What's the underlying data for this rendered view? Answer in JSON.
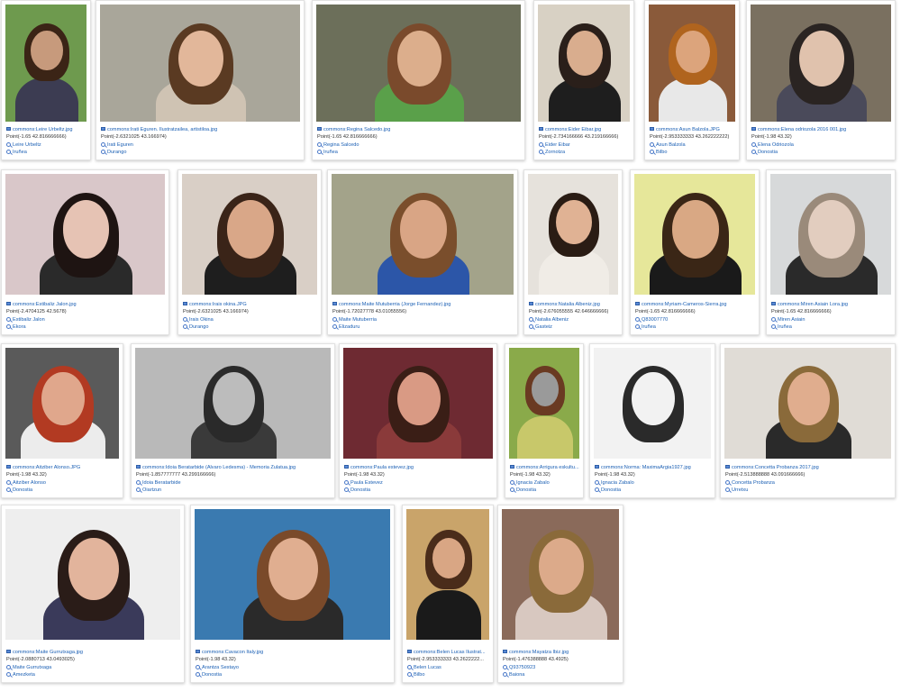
{
  "theme": {
    "link_color": "#1a5fb4",
    "card_border": "#e2e2e2",
    "point_text": "#333333"
  },
  "gallery": {
    "items": [
      {
        "file": "commons:Leire Urbeltz.jpg",
        "point": "Point(-1.65 42.816666666)",
        "person": "Leire Urbeltz",
        "place": "Iruñea",
        "bg": "#6e9a4e",
        "skin": "#c79a7c",
        "hair": "#3b2416",
        "cloth": "#3c3c52"
      },
      {
        "file": "commons:Irati Eguren. Ilustratzailea, artistiloa.jpg",
        "point": "Point(-2.6321025 43.166974)",
        "person": "Irati Eguren",
        "place": "Durango",
        "bg": "#a9a69a",
        "skin": "#e2b79a",
        "hair": "#5a3a22",
        "cloth": "#cfc3b3"
      },
      {
        "file": "commons:Regina Salcedo.jpg",
        "point": "Point(-1.65 42.816666666)",
        "person": "Regina Salcedo",
        "place": "Iruñea",
        "bg": "#6c6f5a",
        "skin": "#dcae8c",
        "hair": "#7a4a2c",
        "cloth": "#5aa04a"
      },
      {
        "file": "commons:Eider Eibar.jpg",
        "point": "Point(-2.734166666 43.219166666)",
        "person": "Eider Eibar",
        "place": "Zornotza",
        "bg": "#d8d1c4",
        "skin": "#d9ad8e",
        "hair": "#2a1f1a",
        "cloth": "#1e1e1e"
      },
      {
        "file": "commons:Asun Balzola.JPG",
        "point": "Point(-2.953333333 43.262222222)",
        "person": "Asun Balzola",
        "place": "Bilbo",
        "bg": "#8a5a3a",
        "skin": "#dca47c",
        "hair": "#b0641e",
        "cloth": "#e8e8e8"
      },
      {
        "file": "commons:Elena odriozola 2016 001.jpg",
        "point": "Point(-1.98 43.32)",
        "person": "Elena Odriozola",
        "place": "Donostia",
        "bg": "#7a7060",
        "skin": "#e0c2ad",
        "hair": "#2a2422",
        "cloth": "#4a4a5a"
      },
      {
        "file": "commons:Estibaliz Jalon.jpg",
        "point": "Point(-2.4704125 42.5678)",
        "person": "Estibaliz Jalon",
        "place": "Ekora",
        "bg": "#d9c7c9",
        "skin": "#e6c3b4",
        "hair": "#1e1412",
        "cloth": "#2a2a2a"
      },
      {
        "file": "commons:Irais okina.JPG",
        "point": "Point(-2.6321025 43.166974)",
        "person": "Irais Okina",
        "place": "Durango",
        "bg": "#d9cfc6",
        "skin": "#d9a788",
        "hair": "#3a2418",
        "cloth": "#1e1e1e"
      },
      {
        "file": "commons:Maite Mutuberria (Jorge Fernandez).jpg",
        "point": "Point(-1.72027778 43.01055556)",
        "person": "Maite Mutuberria",
        "place": "Elizaduru",
        "bg": "#a3a38a",
        "skin": "#d9a585",
        "hair": "#7a4e2c",
        "cloth": "#2c56a8"
      },
      {
        "file": "commons:Natalia Albeniz.jpg",
        "point": "Point(-2.676055555 42.646666666)",
        "person": "Natalia Albeniz",
        "place": "Gasteiz",
        "bg": "#e6e2dc",
        "skin": "#e0b294",
        "hair": "#2a1c14",
        "cloth": "#f0ece6"
      },
      {
        "file": "commons:Myriam-Cameros-Sierra.jpg",
        "point": "Point(-1.65 42.816666666)",
        "person": "Q83007770",
        "place": "Iruñea",
        "bg": "#e6e79a",
        "skin": "#d9a884",
        "hair": "#3a2616",
        "cloth": "#1a1a1a"
      },
      {
        "file": "commons:Miren Asiain Lora.jpg",
        "point": "Point(-1.65 42.816666666)",
        "person": "Miren Asiain",
        "place": "Iruñea",
        "bg": "#d7d9da",
        "skin": "#e2cdbf",
        "hair": "#9a8a7a",
        "cloth": "#2a2a2a"
      },
      {
        "file": "commons:Aitziber Alonso.JPG",
        "point": "Point(-1.98 43.32)",
        "person": "Aitziber Alonso",
        "place": "Donostia",
        "bg": "#5a5a5a",
        "skin": "#e0a78c",
        "hair": "#b23a22",
        "cloth": "#ececec"
      },
      {
        "file": "commons:Idoia Beratarbide (Alvaro Ledesma) - Memoria Zulatua.jpg",
        "point": "Point(-1.857777777 43.299166666)",
        "person": "Idoia Beratarbide",
        "place": "Oiartzun",
        "bg": "#b9b9b9",
        "skin": "#bcbcbc",
        "hair": "#2a2a2a",
        "cloth": "#3a3a3a"
      },
      {
        "file": "commons:Paula estevez.jpg",
        "point": "Point(-1.98 43.32)",
        "person": "Paula Estevez",
        "place": "Donostia",
        "bg": "#6e2a32",
        "skin": "#d99a84",
        "hair": "#3a1e16",
        "cloth": "#8a3a3a"
      },
      {
        "file": "commons:Arrigura eskultu...",
        "point": "Point(-1.98 43.32)",
        "person": "Ignacia Zabalo",
        "place": "Donostia",
        "bg": "#8aaa4a",
        "skin": "#9a9a9a",
        "hair": "#6a3a22",
        "cloth": "#c8c86a"
      },
      {
        "file": "commons:Norma: MaximaArgia1927.jpg",
        "point": "Point(-1.98 43.32)",
        "person": "Ignacia Zabalo",
        "place": "Donostia",
        "bg": "#f2f2f2",
        "skin": "#f2f2f2",
        "hair": "#2a2a2a",
        "cloth": "#f2f2f2"
      },
      {
        "file": "commons:Concetta Probanza 2017.jpg",
        "point": "Point(-2.513888888 43.091666666)",
        "person": "Concetta Probanza",
        "place": "Urretxu",
        "bg": "#e0dcd6",
        "skin": "#e0ad8e",
        "hair": "#8a6a3a",
        "cloth": "#2a2a2a"
      },
      {
        "file": "commons:Maite Gurrutxaga.jpg",
        "point": "Point(-2.0880713 43.0493025)",
        "person": "Maite Gurrutxaga",
        "place": "Amezketa",
        "bg": "#eeeeee",
        "skin": "#e2b49c",
        "hair": "#2a1c18",
        "cloth": "#3a3a5a"
      },
      {
        "file": "commons:Cavacon Italy.jpg",
        "point": "Point(-1.98 43.32)",
        "person": "Arantza Sestayo",
        "place": "Donostia",
        "bg": "#3a7ab0",
        "skin": "#e0ae90",
        "hair": "#7a4a2a",
        "cloth": "#2a2a2a"
      },
      {
        "file": "commons:Belen Lucas Ilustrat...",
        "point": "Point(-2.953333333 43.2622222...",
        "person": "Belen Lucas",
        "place": "Bilbo",
        "bg": "#c9a46a",
        "skin": "#d9a684",
        "hair": "#4a2c1a",
        "cloth": "#1a1a1a"
      },
      {
        "file": "commons:Mayatza Ibiz.jpg",
        "point": "Point(-1.476388888 43.4925)",
        "person": "Q93750923",
        "place": "Baiona",
        "bg": "#8a6a5a",
        "skin": "#dcaa8a",
        "hair": "#8a6a3a",
        "cloth": "#d8c8c0"
      }
    ]
  }
}
